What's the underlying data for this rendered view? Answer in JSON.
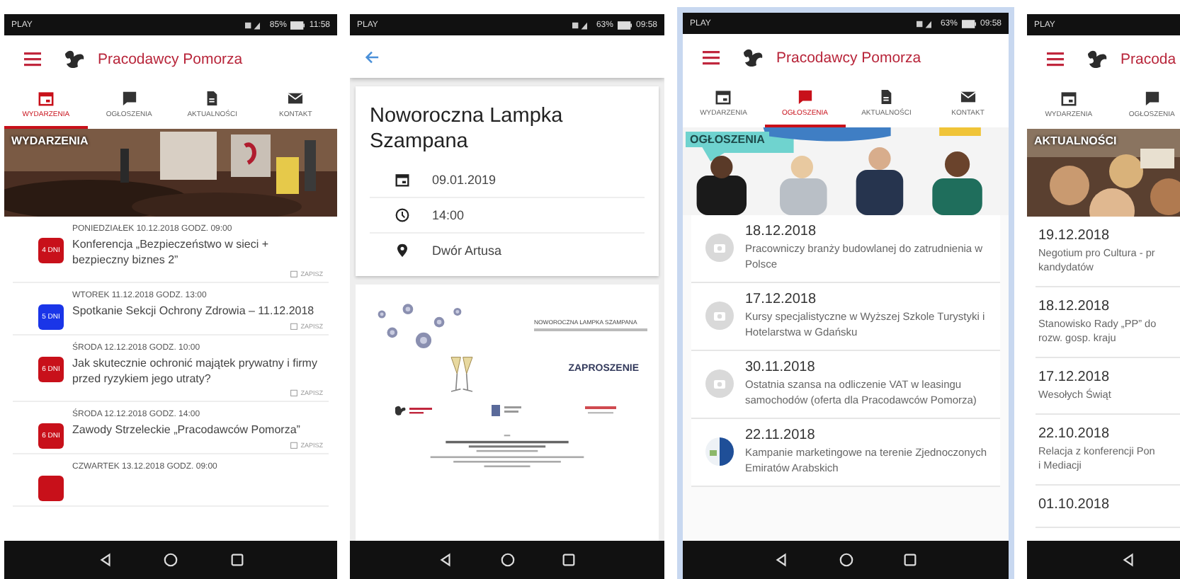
{
  "screens": [
    {
      "kind": "list",
      "highlighted": false,
      "status": {
        "carrier": "PLAY",
        "battery": "85%",
        "time": "11:58"
      },
      "app_title": "Pracodawcy Pomorza",
      "tabs": [
        {
          "label": "WYDARZENIA",
          "selected": true
        },
        {
          "label": "OGŁOSZENIA",
          "selected": false
        },
        {
          "label": "AKTUALNOŚCI",
          "selected": false
        },
        {
          "label": "KONTAKT",
          "selected": false
        }
      ],
      "banner": "WYDARZENIA",
      "items": [
        {
          "kind": "event",
          "badge": "4 DNI",
          "color": "#c8101a",
          "when": "PONIEDZIAŁEK 10.12.2018 GODZ. 09:00",
          "title": "Konferencja „Bezpieczeństwo w sieci + bezpieczny biznes 2”",
          "action": "ZAPISZ"
        },
        {
          "kind": "event",
          "badge": "5 DNI",
          "color": "#1a35e8",
          "when": "WTOREK 11.12.2018 GODZ. 13:00",
          "title": "Spotkanie Sekcji Ochrony Zdrowia – 11.12.2018",
          "action": "ZAPISZ"
        },
        {
          "kind": "event",
          "badge": "6 DNI",
          "color": "#c8101a",
          "when": "ŚRODA 12.12.2018 GODZ. 10:00",
          "title": "Jak skutecznie ochronić majątek prywatny i firmy przed ryzykiem jego utraty?",
          "action": "ZAPISZ"
        },
        {
          "kind": "event",
          "badge": "6 DNI",
          "color": "#c8101a",
          "when": "ŚRODA 12.12.2018 GODZ. 14:00",
          "title": "Zawody Strzeleckie „Pracodawców Pomorza”",
          "action": "ZAPISZ"
        },
        {
          "kind": "event",
          "color": "#c8101a",
          "when": "CZWARTEK 13.12.2018 GODZ. 09:00"
        }
      ]
    },
    {
      "kind": "detail",
      "highlighted": false,
      "status": {
        "carrier": "PLAY",
        "battery": "63%",
        "time": "09:58"
      },
      "title": "Noworoczna Lampka Szampana",
      "details": [
        {
          "kind": "date",
          "text": "09.01.2019"
        },
        {
          "kind": "time",
          "text": "14:00"
        },
        {
          "kind": "place",
          "text": "Dwór Artusa"
        }
      ],
      "poster": {
        "heading": "NOWOROCZNA LAMPKA SZAMPANA",
        "caption": "ZAPROSZENIE"
      }
    },
    {
      "kind": "list",
      "highlighted": true,
      "status": {
        "carrier": "PLAY",
        "battery": "63%",
        "time": "09:58"
      },
      "app_title": "Pracodawcy Pomorza",
      "tabs": [
        {
          "label": "WYDARZENIA",
          "selected": false
        },
        {
          "label": "OGŁOSZENIA",
          "selected": true
        },
        {
          "label": "AKTUALNOŚCI",
          "selected": false
        },
        {
          "label": "KONTAKT",
          "selected": false
        }
      ],
      "banner": "OGŁOSZENIA",
      "items": [
        {
          "kind": "notice",
          "date": "18.12.2018",
          "text": "Pracowniczy branży budowlanej do zatrudnienia w Polsce"
        },
        {
          "kind": "notice",
          "date": "17.12.2018",
          "text": "Kursy specjalistyczne w Wyższej Szkole Turystyki i Hotelarstwa w Gdańsku"
        },
        {
          "kind": "notice",
          "date": "30.11.2018",
          "text": "Ostatnia szansa na odliczenie VAT w leasingu samochodów (oferta dla Pracodawców Pomorza)"
        },
        {
          "kind": "photo_notice",
          "date": "22.11.2018",
          "text": "Kampanie marketingowe na terenie Zjednoczonych Emiratów Arabskich"
        }
      ]
    },
    {
      "kind": "list",
      "highlighted": false,
      "status": {
        "carrier": "PLAY"
      },
      "app_title": "Pracoda",
      "tabs": [
        {
          "label": "WYDARZENIA",
          "selected": false
        },
        {
          "label": "OGŁOSZENIA",
          "selected": false
        }
      ],
      "banner": "AKTUALNOŚCI",
      "items": [
        {
          "kind": "news",
          "date": "19.12.2018",
          "text": "Negotium pro Cultura - pr",
          "text_2": "kandydatów"
        },
        {
          "kind": "news",
          "date": "18.12.2018",
          "text": "Stanowisko Rady „PP” do",
          "text_2": "rozw. gosp. kraju"
        },
        {
          "kind": "news",
          "date": "17.12.2018",
          "text": "Wesołych Świąt"
        },
        {
          "kind": "news",
          "date": "22.10.2018",
          "text": "Relacja z konferencji Pon",
          "text_2": "i Mediacji"
        },
        {
          "kind": "news",
          "date": "01.10.2018"
        }
      ]
    }
  ]
}
